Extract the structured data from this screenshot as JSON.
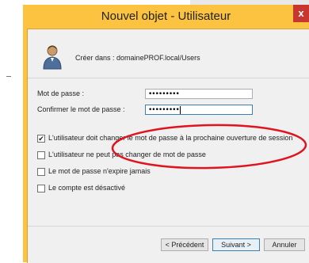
{
  "dialog": {
    "title": "Nouvel objet - Utilisateur",
    "close_glyph": "x"
  },
  "header": {
    "create_in_label": "Créer dans :",
    "create_in_path": "domainePROF.local/Users",
    "icon": "user-icon"
  },
  "form": {
    "password_label": "Mot de passe :",
    "password_value": "•••••••••",
    "confirm_label": "Confirmer le mot de passe :",
    "confirm_value": "•••••••••"
  },
  "options": [
    {
      "label": "L'utilisateur doit changer le mot de passe à la prochaine ouverture de session",
      "checked": true
    },
    {
      "label": "L'utilisateur ne peut pas changer de mot de passe",
      "checked": false
    },
    {
      "label": "Le mot de passe n'expire jamais",
      "checked": false
    },
    {
      "label": "Le compte est désactivé",
      "checked": false
    }
  ],
  "check_glyph": "✔",
  "buttons": {
    "back": "< Précédent",
    "next": "Suivant >",
    "cancel": "Annuler"
  },
  "colors": {
    "window_frame": "#fbc33f",
    "close_button": "#c7372f",
    "annotation": "#e0141e"
  }
}
